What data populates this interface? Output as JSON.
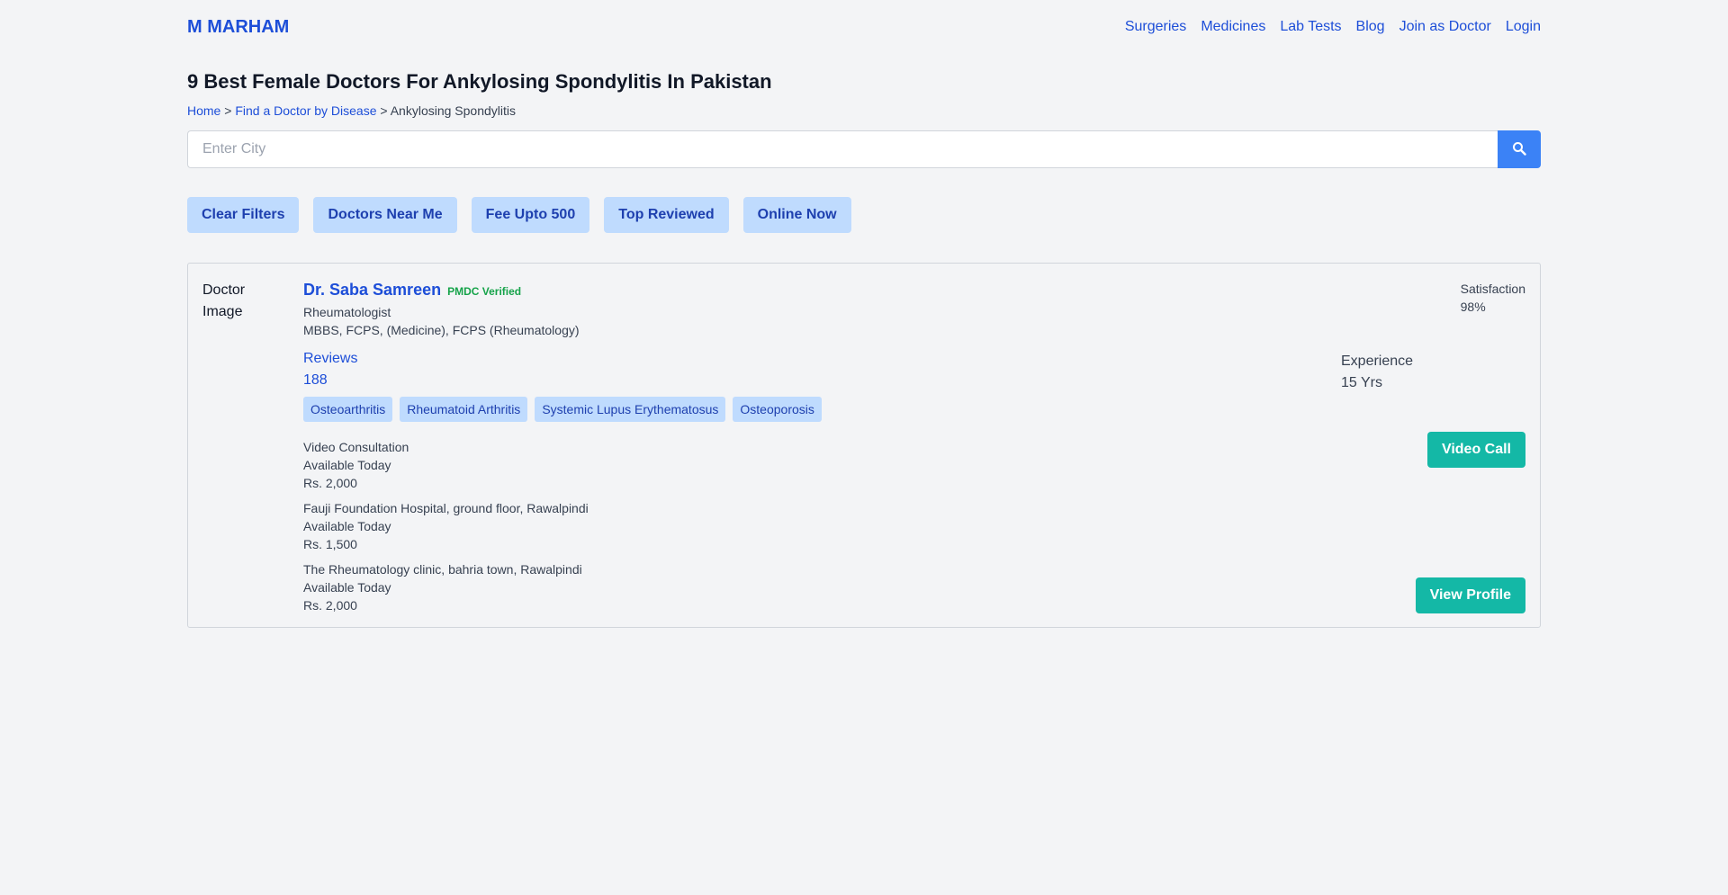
{
  "header": {
    "logo": "M MARHAM",
    "nav": [
      "Surgeries",
      "Medicines",
      "Lab Tests",
      "Blog",
      "Join as Doctor",
      "Login"
    ]
  },
  "page": {
    "title": "9 Best Female Doctors For Ankylosing Spondylitis In Pakistan",
    "breadcrumb": {
      "home": "Home",
      "sep": ">",
      "disease_link": "Find a Doctor by Disease",
      "current": "Ankylosing Spondylitis"
    }
  },
  "search": {
    "placeholder": "Enter City",
    "icon": "search-icon",
    "button_color": "#3b82f6"
  },
  "filters": [
    "Clear Filters",
    "Doctors Near Me",
    "Fee Upto 500",
    "Top Reviewed",
    "Online Now"
  ],
  "doctor": {
    "image_alt": "Doctor Image",
    "name": "Dr. Saba Samreen",
    "verified": "PMDC Verified",
    "specialty": "Rheumatologist",
    "qualifications": "MBBS, FCPS, (Medicine), FCPS (Rheumatology)",
    "reviews_label": "Reviews",
    "reviews_count": "188",
    "satisfaction_label": "Satisfaction",
    "satisfaction_value": "98%",
    "experience_label": "Experience",
    "experience_value": "15 Yrs",
    "tags": [
      "Osteoarthritis",
      "Rheumatoid Arthritis",
      "Systemic Lupus Erythematosus",
      "Osteoporosis"
    ],
    "locations": [
      {
        "name": "Video Consultation",
        "availability": "Available Today",
        "fee": "Rs. 2,000"
      },
      {
        "name": "Fauji Foundation Hospital, ground floor, Rawalpindi",
        "availability": "Available Today",
        "fee": "Rs. 1,500"
      },
      {
        "name": "The Rheumatology clinic, bahria town, Rawalpindi",
        "availability": "Available Today",
        "fee": "Rs. 2,000"
      }
    ],
    "video_call_label": "Video Call",
    "view_profile_label": "View Profile"
  },
  "colors": {
    "brand": "#1d4ed8",
    "accent_green": "#14b8a6",
    "verified_green": "#16a34a",
    "chip_bg": "#bfdbfe"
  }
}
